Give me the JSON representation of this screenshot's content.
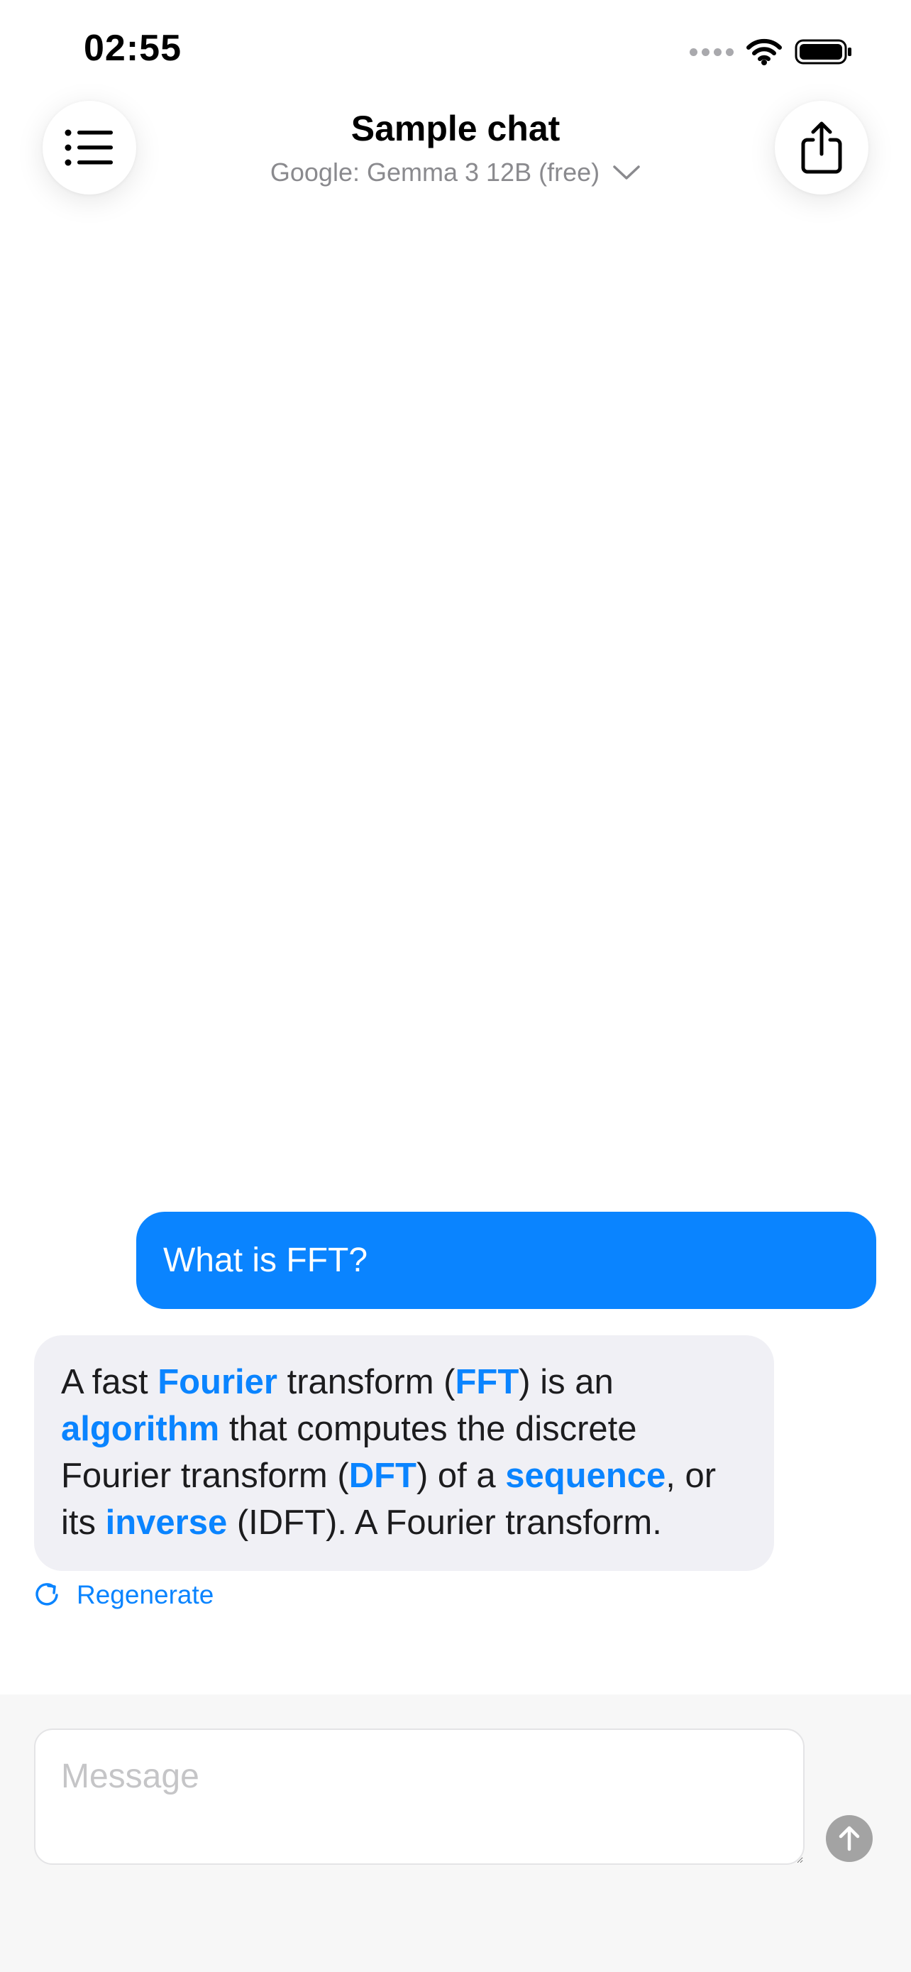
{
  "status_bar": {
    "time": "02:55"
  },
  "header": {
    "title": "Sample chat",
    "model": "Google: Gemma 3 12B (free)",
    "menu_icon": "list-icon",
    "share_icon": "share-icon"
  },
  "messages": {
    "user": {
      "text": "What is FFT?"
    },
    "assistant": {
      "segments": [
        {
          "text": "A fast ",
          "link": false
        },
        {
          "text": "Fourier",
          "link": true
        },
        {
          "text": " transform (",
          "link": false
        },
        {
          "text": "FFT",
          "link": true
        },
        {
          "text": ") is an ",
          "link": false
        },
        {
          "text": "algorithm",
          "link": true
        },
        {
          "text": " that computes the discrete Fourier transform (",
          "link": false
        },
        {
          "text": "DFT",
          "link": true
        },
        {
          "text": ") of a ",
          "link": false
        },
        {
          "text": "sequence",
          "link": true
        },
        {
          "text": ", or its ",
          "link": false
        },
        {
          "text": "inverse",
          "link": true
        },
        {
          "text": " (IDFT). A Fourier transform.",
          "link": false
        }
      ]
    },
    "regenerate_label": "Regenerate"
  },
  "composer": {
    "placeholder": "Message",
    "value": ""
  },
  "colors": {
    "accent": "#0a84ff",
    "assistant_bubble": "#f0f0f5",
    "send_disabled": "#a3a3a3"
  }
}
